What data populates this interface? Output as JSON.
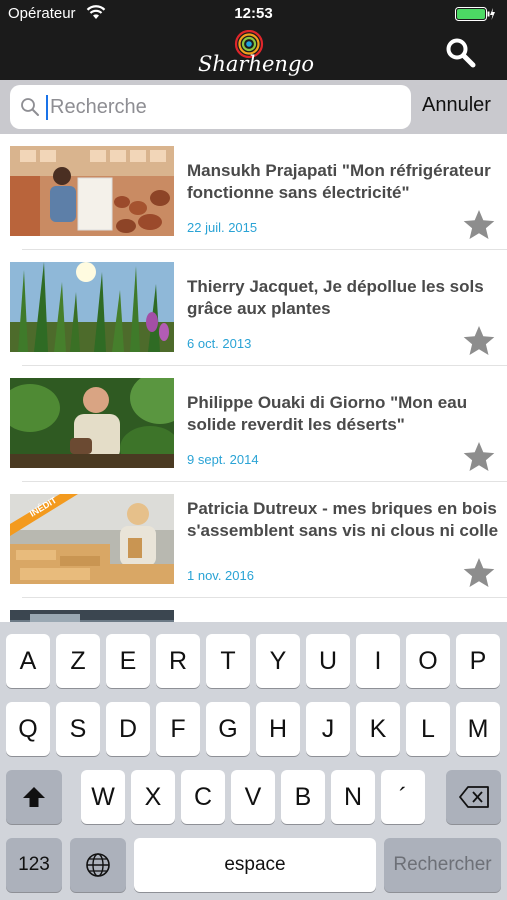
{
  "status": {
    "carrier": "Opérateur",
    "time": "12:53",
    "battery_level": 1.0
  },
  "app": {
    "logo_text": "Sharhengo"
  },
  "search": {
    "placeholder": "Recherche",
    "value": "",
    "cancel_label": "Annuler"
  },
  "results": [
    {
      "title": "Mansukh Prajapati \"Mon réfrigérateur fonctionne sans électricité\"",
      "date": "22 juil. 2015",
      "badge": ""
    },
    {
      "title": "Thierry Jacquet, Je dépollue les sols grâce aux plantes",
      "date": "6 oct. 2013",
      "badge": ""
    },
    {
      "title": "Philippe Ouaki di Giorno \"Mon eau solide reverdit les déserts\"",
      "date": "9 sept. 2014",
      "badge": ""
    },
    {
      "title": "Patricia Dutreux - mes briques en bois s'assemblent sans vis ni clous ni colle",
      "date": "1 nov. 2016",
      "badge": "INÉDIT"
    }
  ],
  "keyboard": {
    "row1": [
      "A",
      "Z",
      "E",
      "R",
      "T",
      "Y",
      "U",
      "I",
      "O",
      "P"
    ],
    "row2": [
      "Q",
      "S",
      "D",
      "F",
      "G",
      "H",
      "J",
      "K",
      "L",
      "M"
    ],
    "row3": [
      "W",
      "X",
      "C",
      "V",
      "B",
      "N",
      "´"
    ],
    "numbers_label": "123",
    "space_label": "espace",
    "action_label": "Rechercher"
  },
  "colors": {
    "accent_date": "#2aa3d5",
    "badge": "#f39a1e",
    "nav_bg": "#1b1b1b"
  }
}
